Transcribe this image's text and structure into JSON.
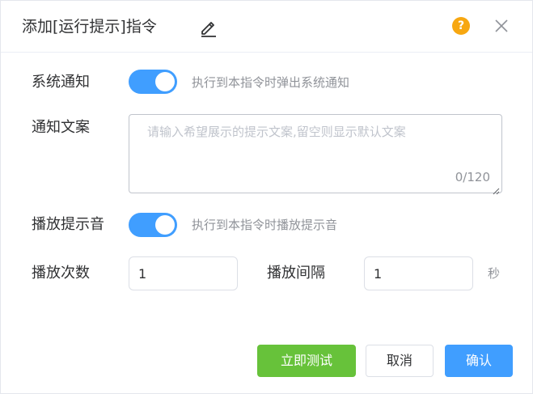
{
  "dialog": {
    "title": "添加[运行提示]指令",
    "help_glyph": "?"
  },
  "system_notify": {
    "label": "系统通知",
    "enabled": true,
    "hint": "执行到本指令时弹出系统通知"
  },
  "notify_text": {
    "label": "通知文案",
    "value": "",
    "placeholder": "请输入希望展示的提示文案,留空则显示默认文案",
    "counter": "0/120"
  },
  "play_sound": {
    "label": "播放提示音",
    "enabled": true,
    "hint": "执行到本指令时播放提示音"
  },
  "play_count": {
    "label": "播放次数",
    "value": "1"
  },
  "play_interval": {
    "label": "播放间隔",
    "value": "1",
    "unit": "秒"
  },
  "footer": {
    "test_label": "立即测试",
    "cancel_label": "取消",
    "ok_label": "确认"
  },
  "colors": {
    "primary": "#409eff",
    "success": "#67c23a",
    "warning": "#f7a711"
  }
}
